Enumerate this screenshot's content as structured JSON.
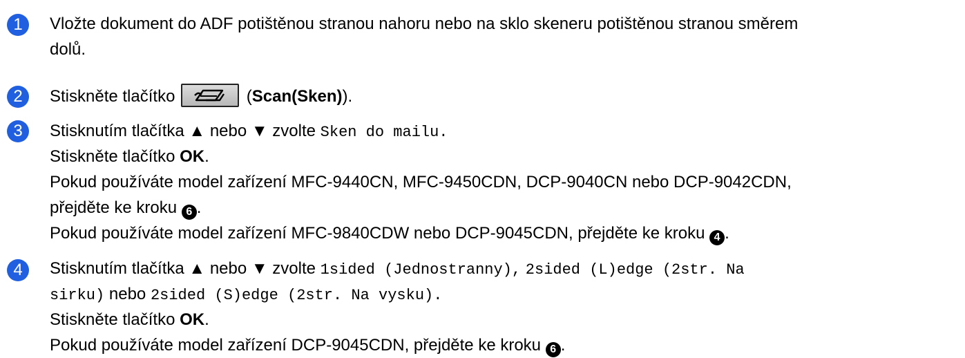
{
  "steps": [
    {
      "number": "1",
      "lines": [
        "Vložte dokument do ADF potištěnou stranou nahoru nebo na sklo skeneru potištěnou stranou směrem",
        "dolů."
      ]
    },
    {
      "number": "2",
      "prefix": "Stiskněte tlačítko",
      "button_label": "Scan(Sken)",
      "button_icon": "scan-icon"
    },
    {
      "number": "3",
      "l1_text": "Stisknutím tlačítka ▲ nebo ▼ zvolte",
      "l1_code": "Sken do mailu.",
      "l2_text": "Stiskněte tlačítko",
      "l2_bold": "OK",
      "l3": "Pokud používáte model zařízení MFC-9440CN, MFC-9450CDN, DCP-9040CN nebo DCP-9042CDN,",
      "l4_text": "přejděte ke kroku",
      "l4_ref": "6",
      "l5_text": "Pokud používáte model zařízení MFC-9840CDW nebo DCP-9045CDN, přejděte ke kroku",
      "l5_ref": "4"
    },
    {
      "number": "4",
      "l1_text": "Stisknutím tlačítka ▲ nebo ▼ zvolte",
      "l1_code1": "1sided (Jednostranny),",
      "l1_code2": "2sided (L)edge (2str. Na",
      "l2_code1": "sirku)",
      "l2_text": "nebo",
      "l2_code2": "2sided (S)edge (2str. Na vysku).",
      "l3_text": "Stiskněte tlačítko",
      "l3_bold": "OK",
      "l4_text": "Pokud používáte model zařízení DCP-9045CDN, přejděte ke kroku",
      "l4_ref": "6"
    }
  ],
  "colors": {
    "badge": "#1f5fe0",
    "text": "#000000"
  }
}
